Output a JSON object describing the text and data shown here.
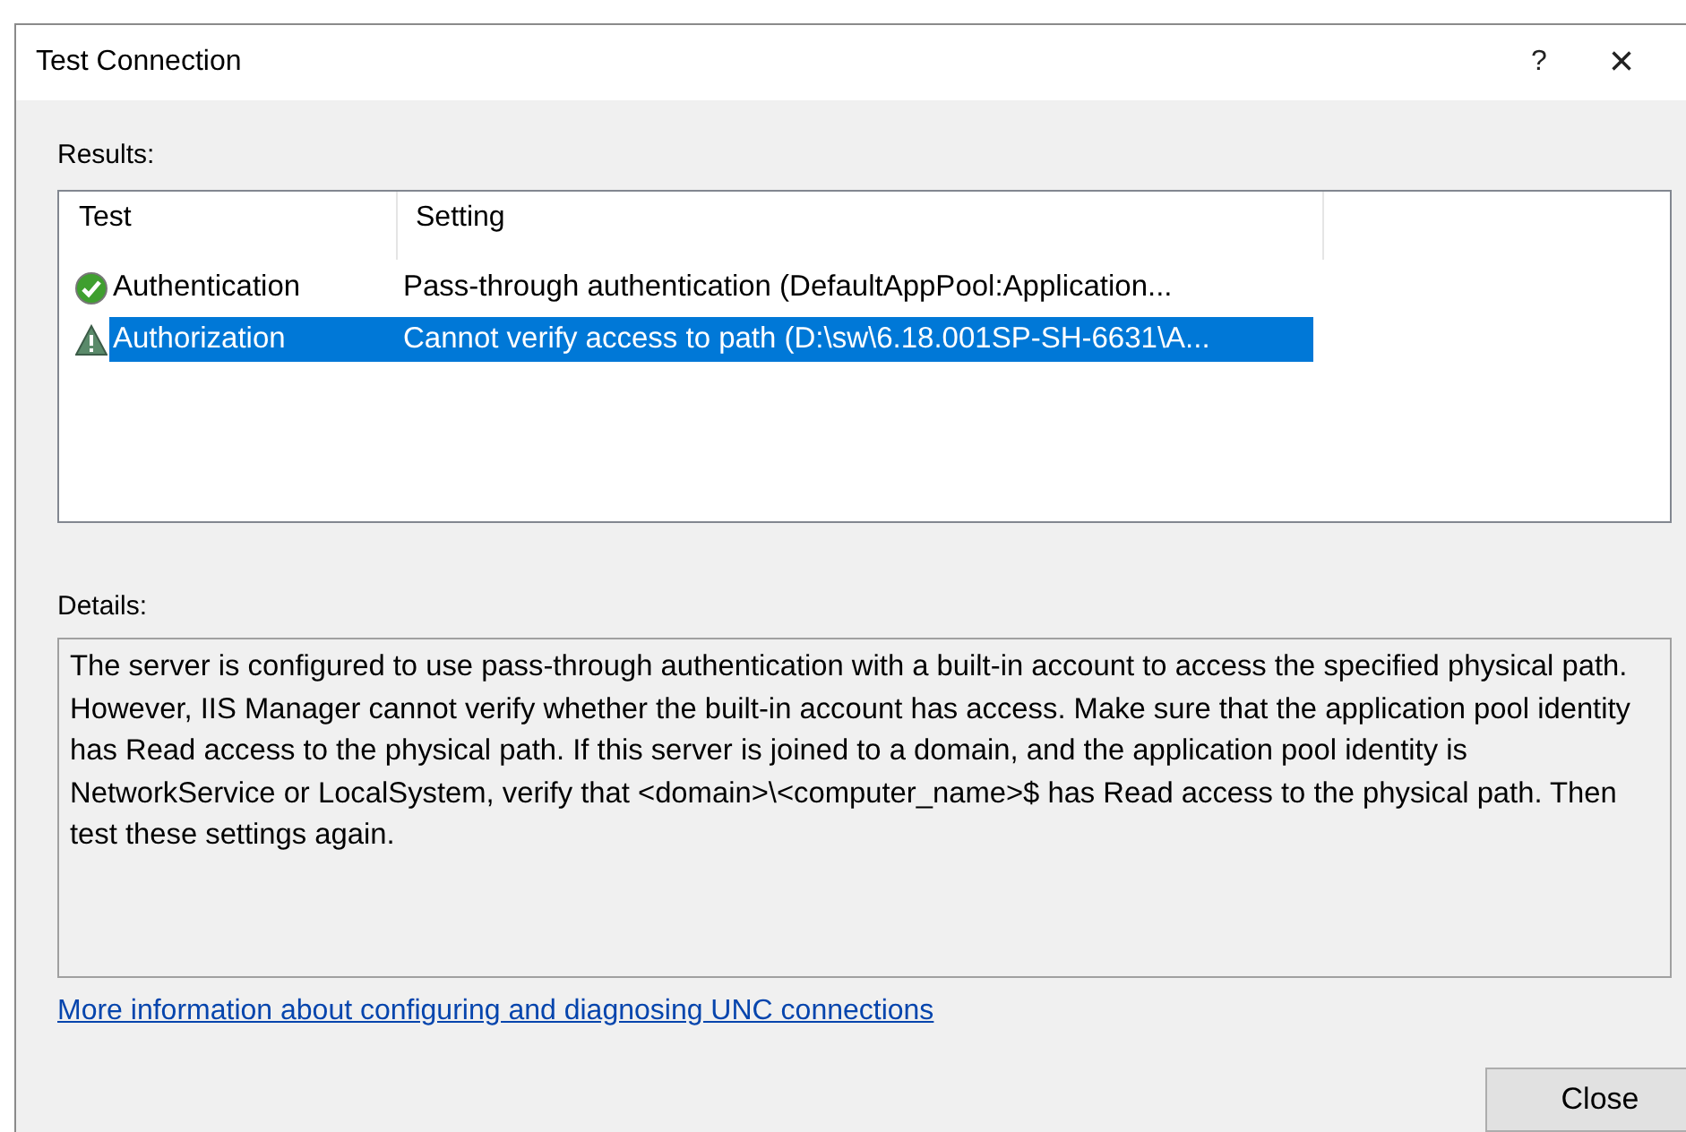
{
  "window": {
    "title": "Test Connection",
    "help": "?",
    "close": "×"
  },
  "results": {
    "label": "Results:",
    "columns": [
      "Test",
      "Setting"
    ],
    "rows": [
      {
        "kind": "success",
        "test": "Authentication",
        "setting": "Pass-through authentication (DefaultAppPool:Application...",
        "selected": false
      },
      {
        "kind": "warning",
        "test": "Authorization",
        "setting": "Cannot verify access to path (D:\\sw\\6.18.001SP-SH-6631\\A...",
        "selected": true
      }
    ]
  },
  "details": {
    "label": "Details:",
    "text": "The server is configured to use pass-through authentication with a built-in account to access the specified physical path. However, IIS Manager cannot verify whether the built-in account has access. Make sure that the application pool identity has Read access to the physical path. If this server is joined to a domain, and the application pool identity is NetworkService or LocalSystem, verify that <domain>\\<computer_name>$ has Read access to the physical path. Then test these settings again."
  },
  "link": "More information about configuring and diagnosing UNC connections",
  "buttons": [
    "Close"
  ]
}
